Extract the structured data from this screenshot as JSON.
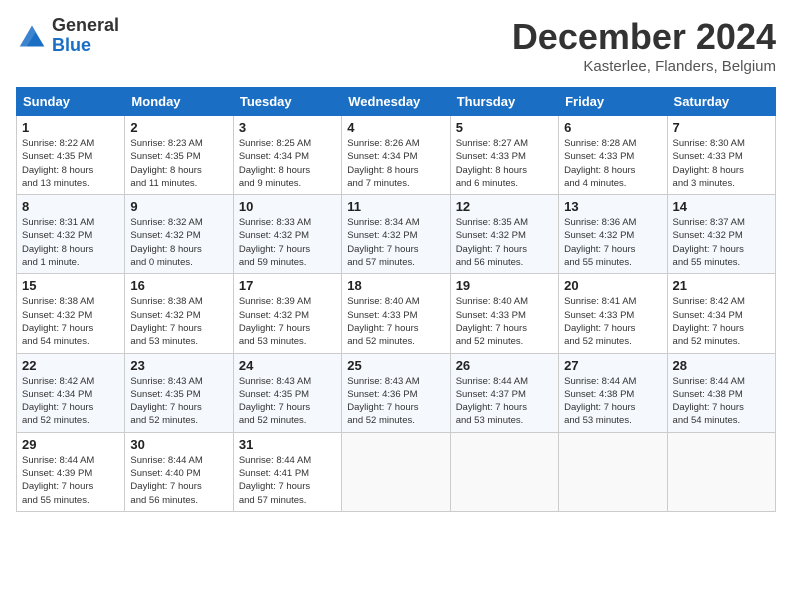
{
  "header": {
    "logo_general": "General",
    "logo_blue": "Blue",
    "month_title": "December 2024",
    "location": "Kasterlee, Flanders, Belgium"
  },
  "columns": [
    "Sunday",
    "Monday",
    "Tuesday",
    "Wednesday",
    "Thursday",
    "Friday",
    "Saturday"
  ],
  "weeks": [
    [
      {
        "day": "1",
        "info": "Sunrise: 8:22 AM\nSunset: 4:35 PM\nDaylight: 8 hours\nand 13 minutes."
      },
      {
        "day": "2",
        "info": "Sunrise: 8:23 AM\nSunset: 4:35 PM\nDaylight: 8 hours\nand 11 minutes."
      },
      {
        "day": "3",
        "info": "Sunrise: 8:25 AM\nSunset: 4:34 PM\nDaylight: 8 hours\nand 9 minutes."
      },
      {
        "day": "4",
        "info": "Sunrise: 8:26 AM\nSunset: 4:34 PM\nDaylight: 8 hours\nand 7 minutes."
      },
      {
        "day": "5",
        "info": "Sunrise: 8:27 AM\nSunset: 4:33 PM\nDaylight: 8 hours\nand 6 minutes."
      },
      {
        "day": "6",
        "info": "Sunrise: 8:28 AM\nSunset: 4:33 PM\nDaylight: 8 hours\nand 4 minutes."
      },
      {
        "day": "7",
        "info": "Sunrise: 8:30 AM\nSunset: 4:33 PM\nDaylight: 8 hours\nand 3 minutes."
      }
    ],
    [
      {
        "day": "8",
        "info": "Sunrise: 8:31 AM\nSunset: 4:32 PM\nDaylight: 8 hours\nand 1 minute."
      },
      {
        "day": "9",
        "info": "Sunrise: 8:32 AM\nSunset: 4:32 PM\nDaylight: 8 hours\nand 0 minutes."
      },
      {
        "day": "10",
        "info": "Sunrise: 8:33 AM\nSunset: 4:32 PM\nDaylight: 7 hours\nand 59 minutes."
      },
      {
        "day": "11",
        "info": "Sunrise: 8:34 AM\nSunset: 4:32 PM\nDaylight: 7 hours\nand 57 minutes."
      },
      {
        "day": "12",
        "info": "Sunrise: 8:35 AM\nSunset: 4:32 PM\nDaylight: 7 hours\nand 56 minutes."
      },
      {
        "day": "13",
        "info": "Sunrise: 8:36 AM\nSunset: 4:32 PM\nDaylight: 7 hours\nand 55 minutes."
      },
      {
        "day": "14",
        "info": "Sunrise: 8:37 AM\nSunset: 4:32 PM\nDaylight: 7 hours\nand 55 minutes."
      }
    ],
    [
      {
        "day": "15",
        "info": "Sunrise: 8:38 AM\nSunset: 4:32 PM\nDaylight: 7 hours\nand 54 minutes."
      },
      {
        "day": "16",
        "info": "Sunrise: 8:38 AM\nSunset: 4:32 PM\nDaylight: 7 hours\nand 53 minutes."
      },
      {
        "day": "17",
        "info": "Sunrise: 8:39 AM\nSunset: 4:32 PM\nDaylight: 7 hours\nand 53 minutes."
      },
      {
        "day": "18",
        "info": "Sunrise: 8:40 AM\nSunset: 4:33 PM\nDaylight: 7 hours\nand 52 minutes."
      },
      {
        "day": "19",
        "info": "Sunrise: 8:40 AM\nSunset: 4:33 PM\nDaylight: 7 hours\nand 52 minutes."
      },
      {
        "day": "20",
        "info": "Sunrise: 8:41 AM\nSunset: 4:33 PM\nDaylight: 7 hours\nand 52 minutes."
      },
      {
        "day": "21",
        "info": "Sunrise: 8:42 AM\nSunset: 4:34 PM\nDaylight: 7 hours\nand 52 minutes."
      }
    ],
    [
      {
        "day": "22",
        "info": "Sunrise: 8:42 AM\nSunset: 4:34 PM\nDaylight: 7 hours\nand 52 minutes."
      },
      {
        "day": "23",
        "info": "Sunrise: 8:43 AM\nSunset: 4:35 PM\nDaylight: 7 hours\nand 52 minutes."
      },
      {
        "day": "24",
        "info": "Sunrise: 8:43 AM\nSunset: 4:35 PM\nDaylight: 7 hours\nand 52 minutes."
      },
      {
        "day": "25",
        "info": "Sunrise: 8:43 AM\nSunset: 4:36 PM\nDaylight: 7 hours\nand 52 minutes."
      },
      {
        "day": "26",
        "info": "Sunrise: 8:44 AM\nSunset: 4:37 PM\nDaylight: 7 hours\nand 53 minutes."
      },
      {
        "day": "27",
        "info": "Sunrise: 8:44 AM\nSunset: 4:38 PM\nDaylight: 7 hours\nand 53 minutes."
      },
      {
        "day": "28",
        "info": "Sunrise: 8:44 AM\nSunset: 4:38 PM\nDaylight: 7 hours\nand 54 minutes."
      }
    ],
    [
      {
        "day": "29",
        "info": "Sunrise: 8:44 AM\nSunset: 4:39 PM\nDaylight: 7 hours\nand 55 minutes."
      },
      {
        "day": "30",
        "info": "Sunrise: 8:44 AM\nSunset: 4:40 PM\nDaylight: 7 hours\nand 56 minutes."
      },
      {
        "day": "31",
        "info": "Sunrise: 8:44 AM\nSunset: 4:41 PM\nDaylight: 7 hours\nand 57 minutes."
      },
      null,
      null,
      null,
      null
    ]
  ]
}
